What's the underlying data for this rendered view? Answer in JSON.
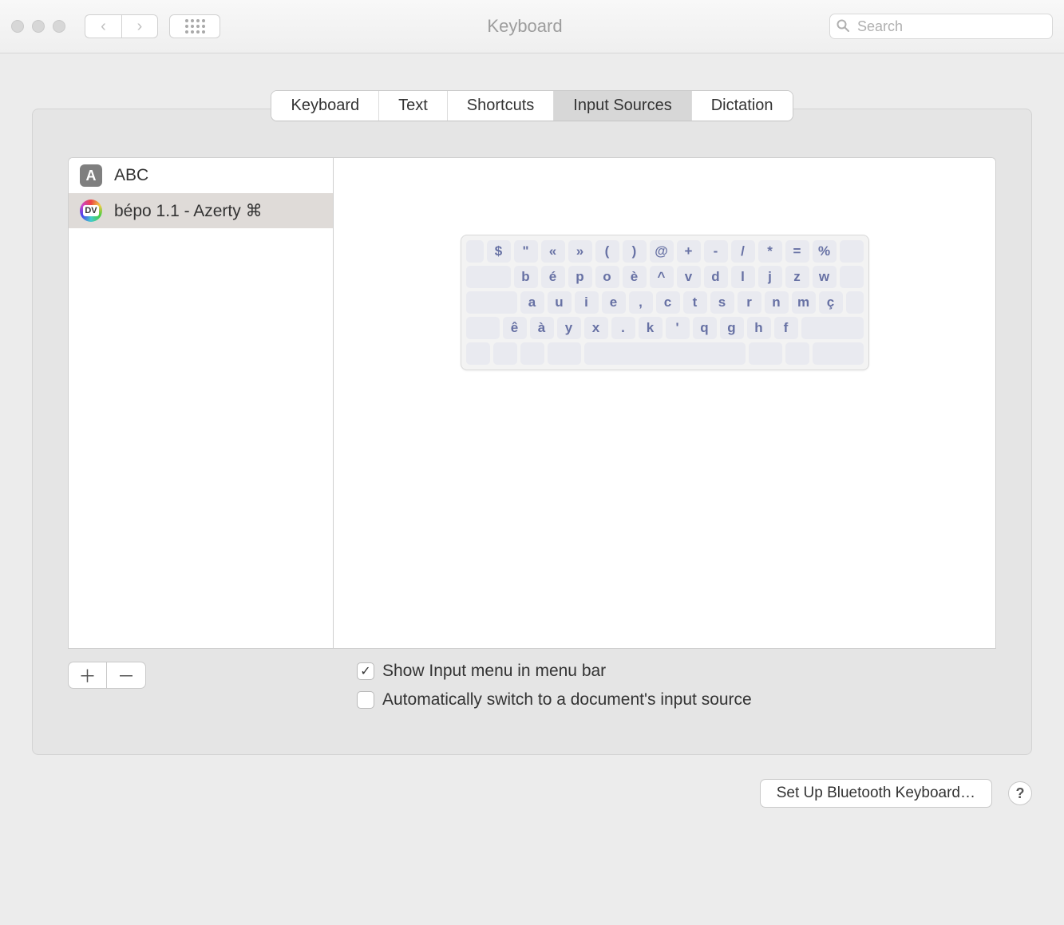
{
  "window": {
    "title": "Keyboard"
  },
  "search": {
    "placeholder": "Search"
  },
  "tabs": {
    "keyboard": "Keyboard",
    "text": "Text",
    "shortcuts": "Shortcuts",
    "input_sources": "Input Sources",
    "dictation": "Dictation"
  },
  "sources": {
    "abc": "ABC",
    "bepo": "bépo 1.1 - Azerty ⌘"
  },
  "keyboard_rows": {
    "r0": {
      "k0": "$",
      "k1": "\"",
      "k2": "«",
      "k3": "»",
      "k4": "(",
      "k5": ")",
      "k6": "@",
      "k7": "+",
      "k8": "-",
      "k9": "/",
      "k10": "*",
      "k11": "=",
      "k12": "%"
    },
    "r1": {
      "k0": "b",
      "k1": "é",
      "k2": "p",
      "k3": "o",
      "k4": "è",
      "k5": "^",
      "k6": "v",
      "k7": "d",
      "k8": "l",
      "k9": "j",
      "k10": "z",
      "k11": "w"
    },
    "r2": {
      "k0": "a",
      "k1": "u",
      "k2": "i",
      "k3": "e",
      "k4": ",",
      "k5": "c",
      "k6": "t",
      "k7": "s",
      "k8": "r",
      "k9": "n",
      "k10": "m",
      "k11": "ç"
    },
    "r3": {
      "k0": "ê",
      "k1": "à",
      "k2": "y",
      "k3": "x",
      "k4": ".",
      "k5": "k",
      "k6": "'",
      "k7": "q",
      "k8": "g",
      "k9": "h",
      "k10": "f"
    }
  },
  "options": {
    "show_input_menu": "Show Input menu in menu bar",
    "auto_switch": "Automatically switch to a document's input source"
  },
  "buttons": {
    "bluetooth": "Set Up Bluetooth Keyboard…"
  }
}
